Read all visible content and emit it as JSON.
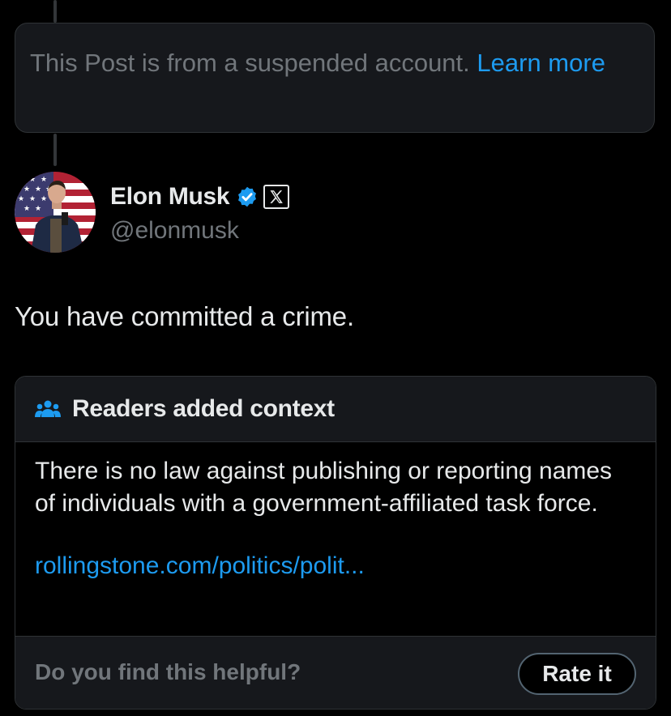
{
  "suspended": {
    "text": "This Post is from a suspended account.",
    "link_label": "Learn more"
  },
  "author": {
    "name": "Elon Musk",
    "handle": "@elonmusk",
    "verified": true,
    "affiliation_badge": "X"
  },
  "post": {
    "text": "You have committed a crime."
  },
  "community_note": {
    "title": "Readers added context",
    "body": "There is no law against publishing or reporting names of individuals with a government-affiliated task force.",
    "link": "rollingstone.com/politics/polit...",
    "helpful_question": "Do you find this helpful?",
    "rate_button": "Rate it"
  },
  "colors": {
    "background": "#000000",
    "link_blue": "#1d9bf0",
    "muted_text": "#71767b",
    "card_bg": "#16181c",
    "border": "#2f3336"
  }
}
